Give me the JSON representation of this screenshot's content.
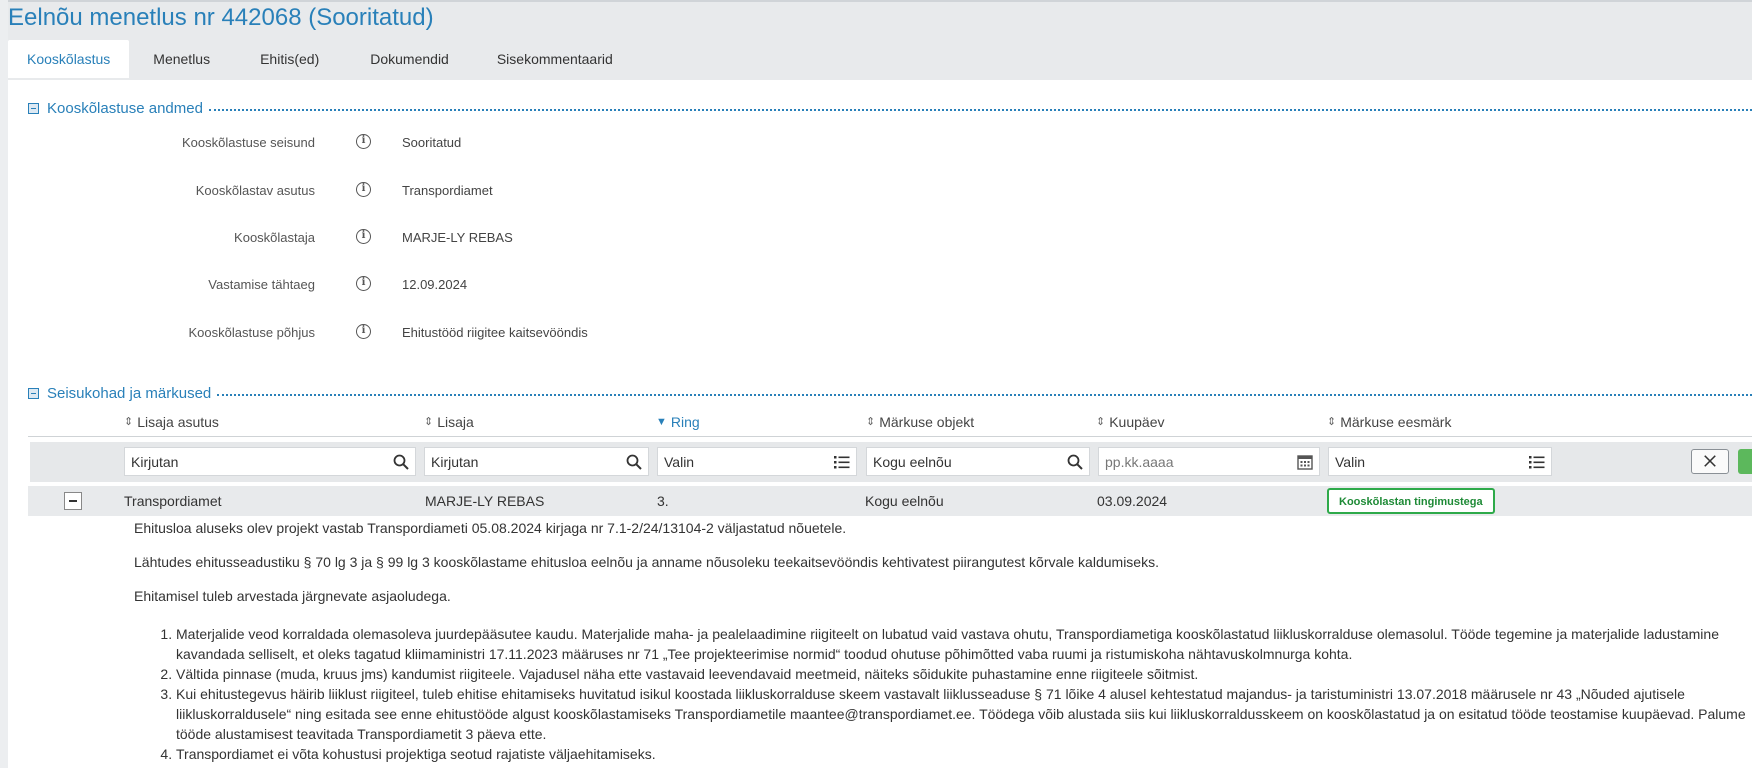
{
  "page": {
    "title": "Eelnõu menetlus nr 442068 (Sooritatud)"
  },
  "tabs": [
    {
      "label": "Kooskõlastus"
    },
    {
      "label": "Menetlus"
    },
    {
      "label": "Ehitis(ed)"
    },
    {
      "label": "Dokumendid"
    },
    {
      "label": "Sisekommentaarid"
    }
  ],
  "section1": {
    "title": "Kooskõlastuse andmed",
    "fields": [
      {
        "label": "Kooskõlastuse seisund",
        "value": "Sooritatud"
      },
      {
        "label": "Kooskõlastav asutus",
        "value": "Transpordiamet"
      },
      {
        "label": "Kooskõlastaja",
        "value": "MARJE-LY REBAS"
      },
      {
        "label": "Vastamise tähtaeg",
        "value": "12.09.2024"
      },
      {
        "label": "Kooskõlastuse põhjus",
        "value": "Ehitustööd riigitee kaitsevööndis"
      }
    ]
  },
  "section2": {
    "title": "Seisukohad ja märkused",
    "columns": [
      {
        "label": "Lisaja asutus",
        "sort": "both"
      },
      {
        "label": "Lisaja",
        "sort": "both"
      },
      {
        "label": "Ring",
        "sort": "desc"
      },
      {
        "label": "Märkuse objekt",
        "sort": "both"
      },
      {
        "label": "Kuupäev",
        "sort": "both"
      },
      {
        "label": "Märkuse eesmärk",
        "sort": "both"
      }
    ],
    "filters": [
      {
        "value": "Kirjutan",
        "placeholder": "",
        "icon": "search-icon"
      },
      {
        "value": "Kirjutan",
        "placeholder": "",
        "icon": "search-icon"
      },
      {
        "value": "Valin",
        "placeholder": "",
        "icon": "list-icon"
      },
      {
        "value": "Kogu eelnõu",
        "placeholder": "",
        "icon": "search-icon"
      },
      {
        "value": "",
        "placeholder": "pp.kk.aaaa",
        "icon": "calendar-icon"
      },
      {
        "value": "Valin",
        "placeholder": "",
        "icon": "list-icon"
      }
    ],
    "row": {
      "asutus": "Transpordiamet",
      "lisaja": "MARJE-LY REBAS",
      "ring": "3.",
      "objekt": "Kogu eelnõu",
      "kuupaev": "03.09.2024",
      "eesmark": "Kooskõlastan tingimustega"
    },
    "detail": {
      "p1": "Ehitusloa aluseks olev projekt vastab Transpordiameti 05.08.2024 kirjaga nr 7.1-2/24/13104-2 väljastatud nõuetele.",
      "p2": "Lähtudes ehitusseadustiku § 70 lg 3 ja § 99 lg 3 kooskõlastame ehitusloa eelnõu ja anname nõusoleku teekaitsevööndis kehtivatest piirangutest kõrvale kaldumiseks.",
      "p3": "Ehitamisel tuleb arvestada järgnevate asjaoludega.",
      "items": [
        "Materjalide veod korraldada olemasoleva juurdepääsutee kaudu. Materjalide maha- ja pealelaadimine riigiteelt on lubatud vaid vastava ohutu, Transpordiametiga kooskõlastatud liikluskorralduse olemasolul. Tööde tegemine ja materjalide ladustamine kavandada selliselt, et oleks tagatud kliimaministri 17.11.2023 määruses nr 71 „Tee projekteerimise normid“ toodud ohutuse põhimõtted vaba ruumi ja ristumiskoha nähtavuskolmnurga kohta.",
        "Vältida pinnase (muda, kruus jms) kandumist riigiteele. Vajadusel näha ette vastavaid leevendavaid meetmeid, näiteks sõidukite puhastamine enne riigiteele sõitmist.",
        "Kui ehitustegevus häirib liiklust riigiteel, tuleb ehitise ehitamiseks huvitatud isikul koostada liikluskorralduse skeem vastavalt liiklusseaduse § 71 lõike 4 alusel kehtestatud majandus- ja taristuministri 13.07.2018 määrusele nr 43 „Nõuded ajutisele liikluskorraldusele“ ning esitada see enne ehitustööde algust kooskõlastamiseks Transpordiametile maantee@transpordiamet.ee. Töödega võib alustada siis kui liikluskorraldusskeem on kooskõlastatud ja on esitatud tööde teostamise kuupäevad. Palume tööde alustamisest teavitada Transpordiametit 3 päeva ette.",
        "Transpordiamet ei võta kohustusi projektiga seotud rajatiste väljaehitamiseks."
      ]
    }
  },
  "colors": {
    "accent": "#2980b9",
    "badge_green": "#2eaa4a",
    "band_gray": "#e8eaec"
  }
}
